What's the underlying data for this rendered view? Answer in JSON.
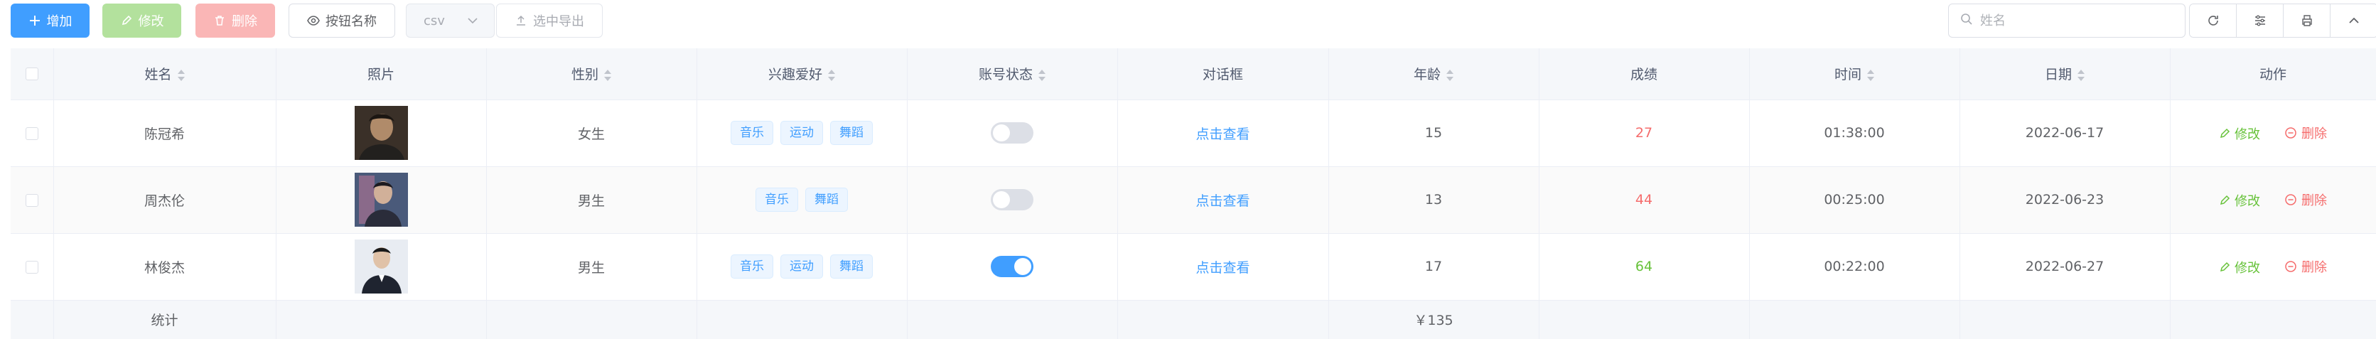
{
  "toolbar": {
    "add_label": "增加",
    "edit_label": "修改",
    "delete_label": "删除",
    "columns_label": "按钮名称",
    "format_value": "csv",
    "export_label": "选中导出"
  },
  "search": {
    "placeholder": "姓名"
  },
  "toolbar_icons": [
    "refresh-icon",
    "filter-icon",
    "print-icon",
    "collapse-icon"
  ],
  "table": {
    "headers": {
      "name": "姓名",
      "photo": "照片",
      "gender": "性别",
      "hobby": "兴趣爱好",
      "status": "账号状态",
      "dialog": "对话框",
      "age": "年龄",
      "score": "成绩",
      "time": "时间",
      "date": "日期",
      "action": "动作"
    },
    "rows": [
      {
        "name": "陈冠希",
        "gender": "女生",
        "hobbies": [
          "音乐",
          "运动",
          "舞蹈"
        ],
        "status_on": false,
        "dialog": "点击查看",
        "age": "15",
        "score": "27",
        "score_color": "#f56c6c",
        "time": "01:38:00",
        "date": "2022-06-17",
        "edit": "修改",
        "delete": "删除"
      },
      {
        "name": "周杰伦",
        "gender": "男生",
        "hobbies": [
          "音乐",
          "舞蹈"
        ],
        "status_on": false,
        "dialog": "点击查看",
        "age": "13",
        "score": "44",
        "score_color": "#f56c6c",
        "time": "00:25:00",
        "date": "2022-06-23",
        "edit": "修改",
        "delete": "删除"
      },
      {
        "name": "林俊杰",
        "gender": "男生",
        "hobbies": [
          "音乐",
          "运动",
          "舞蹈"
        ],
        "status_on": true,
        "dialog": "点击查看",
        "age": "17",
        "score": "64",
        "score_color": "#67c23a",
        "time": "00:22:00",
        "date": "2022-06-27",
        "edit": "修改",
        "delete": "删除"
      }
    ],
    "footer": {
      "label": "统计",
      "age_total": "￥135"
    }
  }
}
